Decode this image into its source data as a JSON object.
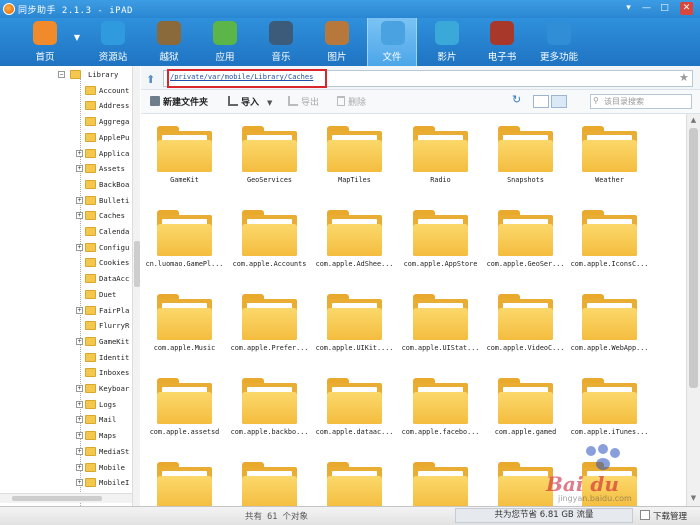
{
  "window": {
    "title": "同步助手 2.1.3 - iPAD",
    "controls": [
      "▾",
      "—",
      "□",
      "✕"
    ]
  },
  "nav": {
    "items": [
      {
        "label": "首页",
        "icon": "home-icon",
        "color": "#f08a2a"
      },
      {
        "label": "资源站",
        "icon": "resource-icon",
        "color": "#2f9bde"
      },
      {
        "label": "越狱",
        "icon": "jailbreak-icon",
        "color": "#8a6a3a"
      },
      {
        "label": "应用",
        "icon": "apps-icon",
        "color": "#5bb548"
      },
      {
        "label": "音乐",
        "icon": "music-icon",
        "color": "#3c5b7a"
      },
      {
        "label": "图片",
        "icon": "photo-icon",
        "color": "#b8783c"
      },
      {
        "label": "文件",
        "icon": "file-icon",
        "color": "#4aa3e0"
      },
      {
        "label": "影片",
        "icon": "video-icon",
        "color": "#3aa8d8"
      },
      {
        "label": "电子书",
        "icon": "ebook-icon",
        "color": "#a8382a"
      },
      {
        "label": "更多功能",
        "icon": "more-icon",
        "color": "#2f8ed6"
      }
    ],
    "active_index": 6
  },
  "sidebar": {
    "root": "Library",
    "items": [
      {
        "label": "Account",
        "expandable": false
      },
      {
        "label": "Address",
        "expandable": false
      },
      {
        "label": "Aggrega",
        "expandable": false
      },
      {
        "label": "ApplePu",
        "expandable": false
      },
      {
        "label": "Applica",
        "expandable": true
      },
      {
        "label": "Assets",
        "expandable": true
      },
      {
        "label": "BackBoa",
        "expandable": false
      },
      {
        "label": "Bulleti",
        "expandable": true
      },
      {
        "label": "Caches",
        "expandable": true
      },
      {
        "label": "Calenda",
        "expandable": false
      },
      {
        "label": "Configu",
        "expandable": true
      },
      {
        "label": "Cookies",
        "expandable": false
      },
      {
        "label": "DataAcc",
        "expandable": false
      },
      {
        "label": "Duet",
        "expandable": false
      },
      {
        "label": "FairPla",
        "expandable": true
      },
      {
        "label": "FlurryR",
        "expandable": false
      },
      {
        "label": "GameKit",
        "expandable": true
      },
      {
        "label": "Identit",
        "expandable": false
      },
      {
        "label": "Inboxes",
        "expandable": false
      },
      {
        "label": "Keyboar",
        "expandable": true
      },
      {
        "label": "Logs",
        "expandable": true
      },
      {
        "label": "Mail",
        "expandable": true
      },
      {
        "label": "Maps",
        "expandable": true
      },
      {
        "label": "MediaSt",
        "expandable": true
      },
      {
        "label": "Mobile",
        "expandable": true
      },
      {
        "label": "MobileI",
        "expandable": true
      }
    ]
  },
  "pathbar": {
    "path": "/private/var/mobile/Library/Caches"
  },
  "toolbar": {
    "new_folder": "新建文件夹",
    "import": "导入",
    "export": "导出",
    "delete": "删除",
    "search_placeholder": "该目录搜索"
  },
  "files": [
    "GameKit",
    "GeoServices",
    "MapTiles",
    "Radio",
    "Snapshots",
    "Weather",
    "cn.luomao.GamePl...",
    "com.apple.Accounts",
    "com.apple.AdShee...",
    "com.apple.AppStore",
    "com.apple.GeoSer...",
    "com.apple.IconsC...",
    "com.apple.Music",
    "com.apple.Prefer...",
    "com.apple.UIKit....",
    "com.apple.UIStat...",
    "com.apple.VideoC...",
    "com.apple.WebApp...",
    "com.apple.assetsd",
    "com.apple.backbo...",
    "com.apple.dataac...",
    "com.apple.facebo...",
    "com.apple.gamed",
    "com.apple.iTunes...",
    "",
    "",
    "",
    "",
    "",
    ""
  ],
  "status": {
    "count": "共有 61 个对象",
    "saved": "共为您节省  6.81 GB 流量",
    "download": "下载管理"
  },
  "watermark": {
    "text": "Bai du",
    "sub": "jingyan.baidu.com"
  }
}
